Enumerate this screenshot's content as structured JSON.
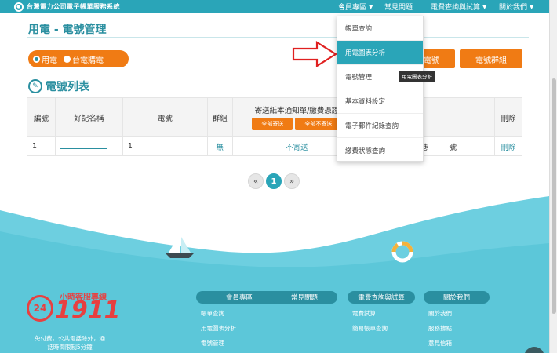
{
  "header": {
    "logo_text": "台灣電力公司電子帳單服務系統",
    "nav": [
      {
        "label": "會員專區",
        "arrow": "▼"
      },
      {
        "label": "常見問題",
        "arrow": ""
      },
      {
        "label": "電費查詢與試算",
        "arrow": "▼"
      },
      {
        "label": "關於我們",
        "arrow": "▼"
      }
    ]
  },
  "page": {
    "title": "用電 - 電號管理",
    "radio_options": [
      "用電",
      "台電購電"
    ],
    "buttons": {
      "add_number": "電號",
      "group": "電號群組"
    },
    "list_title": "電號列表"
  },
  "table": {
    "headers": [
      "編號",
      "好記名稱",
      "電號",
      "群組",
      "寄送紙本通知單/繳費憑證",
      "",
      "刪除"
    ],
    "send_all": "全部寄送",
    "no_send_all": "全部不寄送",
    "rows": [
      {
        "no": "1",
        "nickname": "",
        "number": "1",
        "group": "無",
        "send": "不寄送",
        "address": "段 巷 號",
        "delete": "刪除"
      }
    ]
  },
  "pager": {
    "prev": "«",
    "current": "1",
    "next": "»"
  },
  "dropdown": {
    "items": [
      "帳單查詢",
      "用電圖表分析",
      "電號管理",
      "基本資料設定",
      "電子郵件紀錄查詢",
      "繳費狀態查詢"
    ],
    "active_index": 1,
    "tooltip": "用電圖表分析"
  },
  "footer": {
    "hotline_title": "小時客服專線",
    "hotline_badge": "24",
    "hotline_number": "1911",
    "hotline_note": "免付費，公共電話除外，通話時間限制5分鐘",
    "columns": [
      {
        "title": "會員專區",
        "links": [
          "帳單查詢",
          "用電圖表分析",
          "電號管理"
        ]
      },
      {
        "title": "常見問題",
        "links": []
      },
      {
        "title": "電費查詢與試算",
        "links": [
          "電費試算",
          "簡易帳單查詢"
        ]
      },
      {
        "title": "關於我們",
        "links": [
          "關於我們",
          "服務據點",
          "意見信箱"
        ]
      }
    ]
  },
  "colors": {
    "teal": "#2aa5b8",
    "orange": "#f07b14",
    "red": "#e84040"
  }
}
